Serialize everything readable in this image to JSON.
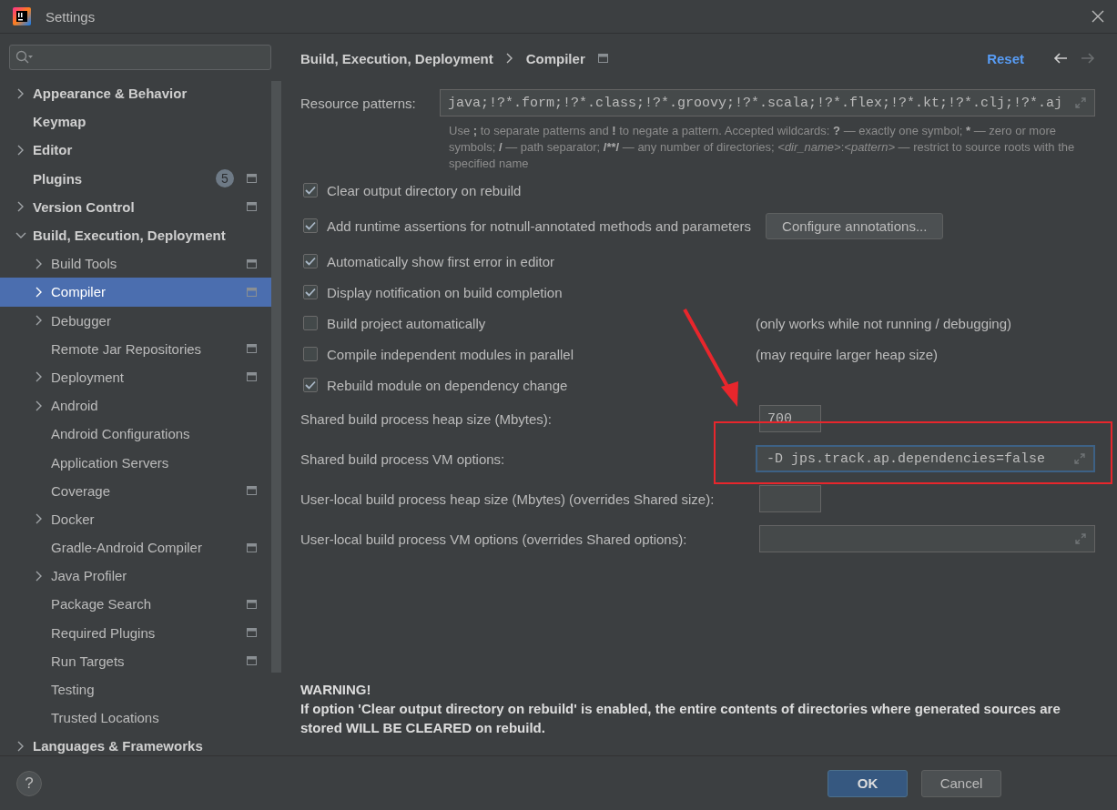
{
  "window": {
    "title": "Settings"
  },
  "tree": [
    {
      "label": "Appearance & Behavior",
      "expandable": true,
      "expanded": false,
      "selected": false,
      "project_icon": false
    },
    {
      "label": "Keymap",
      "expandable": false,
      "selected": false,
      "project_icon": false
    },
    {
      "label": "Editor",
      "expandable": true,
      "expanded": false,
      "selected": false,
      "project_icon": false
    },
    {
      "label": "Plugins",
      "expandable": false,
      "selected": false,
      "project_icon": true,
      "badge": "5"
    },
    {
      "label": "Version Control",
      "expandable": true,
      "expanded": false,
      "selected": false,
      "project_icon": true
    },
    {
      "label": "Build, Execution, Deployment",
      "expandable": true,
      "expanded": true,
      "selected": false,
      "project_icon": false,
      "children": [
        {
          "label": "Build Tools",
          "expandable": true,
          "expanded": false,
          "selected": false,
          "project_icon": true
        },
        {
          "label": "Compiler",
          "expandable": true,
          "expanded": false,
          "selected": true,
          "project_icon": true
        },
        {
          "label": "Debugger",
          "expandable": true,
          "expanded": false,
          "selected": false,
          "project_icon": false
        },
        {
          "label": "Remote Jar Repositories",
          "expandable": false,
          "selected": false,
          "project_icon": true
        },
        {
          "label": "Deployment",
          "expandable": true,
          "expanded": false,
          "selected": false,
          "project_icon": true
        },
        {
          "label": "Android",
          "expandable": true,
          "expanded": false,
          "selected": false,
          "project_icon": false
        },
        {
          "label": "Android Configurations",
          "expandable": false,
          "selected": false,
          "project_icon": false
        },
        {
          "label": "Application Servers",
          "expandable": false,
          "selected": false,
          "project_icon": false
        },
        {
          "label": "Coverage",
          "expandable": false,
          "selected": false,
          "project_icon": true
        },
        {
          "label": "Docker",
          "expandable": true,
          "expanded": false,
          "selected": false,
          "project_icon": false
        },
        {
          "label": "Gradle-Android Compiler",
          "expandable": false,
          "selected": false,
          "project_icon": true
        },
        {
          "label": "Java Profiler",
          "expandable": true,
          "expanded": false,
          "selected": false,
          "project_icon": false
        },
        {
          "label": "Package Search",
          "expandable": false,
          "selected": false,
          "project_icon": true
        },
        {
          "label": "Required Plugins",
          "expandable": false,
          "selected": false,
          "project_icon": true
        },
        {
          "label": "Run Targets",
          "expandable": false,
          "selected": false,
          "project_icon": true
        },
        {
          "label": "Testing",
          "expandable": false,
          "selected": false,
          "project_icon": false
        },
        {
          "label": "Trusted Locations",
          "expandable": false,
          "selected": false,
          "project_icon": false
        }
      ]
    },
    {
      "label": "Languages & Frameworks",
      "expandable": true,
      "expanded": false,
      "selected": false,
      "project_icon": false
    }
  ],
  "breadcrumb": [
    "Build, Execution, Deployment",
    "Compiler"
  ],
  "reset": "Reset",
  "resource_patterns": {
    "label": "Resource patterns:",
    "value": "java;!?*.form;!?*.class;!?*.groovy;!?*.scala;!?*.flex;!?*.kt;!?*.clj;!?*.aj",
    "help": [
      {
        "kind": "plain",
        "text": "Use "
      },
      {
        "kind": "bold",
        "text": ";"
      },
      {
        "kind": "plain",
        "text": " to separate patterns and "
      },
      {
        "kind": "bold",
        "text": "!"
      },
      {
        "kind": "plain",
        "text": " to negate a pattern. Accepted wildcards: "
      },
      {
        "kind": "bold",
        "text": "?"
      },
      {
        "kind": "plain",
        "text": " — exactly one symbol; "
      },
      {
        "kind": "bold",
        "text": "*"
      },
      {
        "kind": "plain",
        "text": " — zero or more symbols; "
      },
      {
        "kind": "bold",
        "text": "/"
      },
      {
        "kind": "plain",
        "text": " — path separator; "
      },
      {
        "kind": "bold",
        "text": "/**/"
      },
      {
        "kind": "plain",
        "text": " — any number of directories; "
      },
      {
        "kind": "italic",
        "text": "<dir_name>"
      },
      {
        "kind": "plain",
        "text": ":"
      },
      {
        "kind": "italic",
        "text": "<pattern>"
      },
      {
        "kind": "plain",
        "text": " — restrict to source roots with the specified name"
      }
    ]
  },
  "options": [
    {
      "label": "Clear output directory on rebuild",
      "checked": true
    },
    {
      "label": "Add runtime assertions for notnull-annotated methods and parameters",
      "checked": true,
      "button": "Configure annotations..."
    },
    {
      "label": "Automatically show first error in editor",
      "checked": true
    },
    {
      "label": "Display notification on build completion",
      "checked": true
    },
    {
      "label": "Build project automatically",
      "checked": false,
      "hint": "(only works while not running / debugging)"
    },
    {
      "label": "Compile independent modules in parallel",
      "checked": false,
      "hint": "(may require larger heap size)"
    },
    {
      "label": "Rebuild module on dependency change",
      "checked": true
    }
  ],
  "fields": [
    {
      "label": "Shared build process heap size (Mbytes):",
      "kind": "short",
      "value": "700",
      "focused": false
    },
    {
      "label": "Shared build process VM options:",
      "kind": "wide",
      "value": "-D jps.track.ap.dependencies=false",
      "focused": true
    },
    {
      "label": "User-local build process heap size (Mbytes) (overrides Shared size):",
      "kind": "short",
      "focused": false
    },
    {
      "label": "User-local build process VM options (overrides Shared options):",
      "kind": "wide",
      "focused": false
    }
  ],
  "warning": {
    "title": "WARNING!",
    "text": "If option 'Clear output directory on rebuild' is enabled, the entire contents of directories where generated sources are stored WILL BE CLEARED on rebuild."
  },
  "footer": {
    "help": "?",
    "buttons": [
      {
        "label": "OK",
        "default": true
      },
      {
        "label": "Cancel",
        "default": false
      }
    ]
  }
}
